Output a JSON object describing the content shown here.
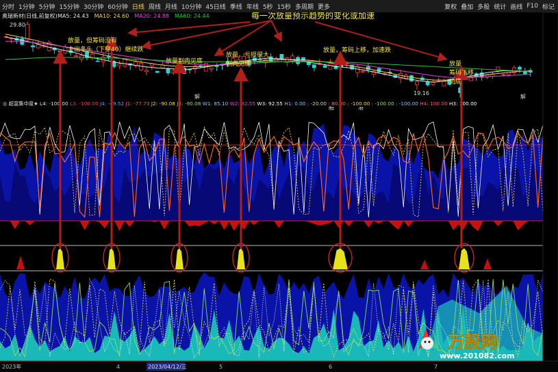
{
  "toolbar": {
    "left": [
      "分时",
      "1分钟",
      "5分钟",
      "15分钟",
      "30分钟",
      "60分钟",
      "日线",
      "周线",
      "月线",
      "10分钟",
      "45日线",
      "季线",
      "年线",
      "5秒",
      "15秒",
      "多周期",
      "更多"
    ],
    "active_index": 6,
    "right": [
      "复权",
      "叠加",
      "多股",
      "统计",
      "画线",
      "F10",
      "标记"
    ]
  },
  "colors": {
    "ma5": "#e8e8e8",
    "ma10": "#f2d24a",
    "ma20": "#e040e0",
    "ma60": "#31c23b",
    "up": "#ff3c3c",
    "down": "#2fd0d0",
    "navy": "#0a13a8",
    "deep": "#06086a",
    "cyan": "#1ab9b9",
    "red": "#c4120e",
    "yellow": "#e7e21c",
    "annotation": "#f5e54a",
    "arrow": "#b0201a"
  },
  "chart_data": [
    {
      "type": "candlestick",
      "title": "奥瑞新材(日线,前复权)",
      "legend": [
        {
          "name": "MA5",
          "value": "24.43"
        },
        {
          "name": "MA10",
          "value": "24.60"
        },
        {
          "name": "MA20",
          "value": "24.88"
        },
        {
          "name": "MA60",
          "value": "24.44"
        }
      ],
      "high_label": "29.80",
      "low_label": "19.16",
      "ylim": [
        18.5,
        30.5
      ],
      "ma_lines": {
        "ma5": [
          27.4,
          27.0,
          26.6,
          26.0,
          25.6,
          25.2,
          24.6,
          24.2,
          23.8,
          23.5,
          23.2,
          23.0,
          22.9,
          22.8,
          23.0,
          23.3,
          23.6,
          23.9,
          24.2,
          24.4,
          24.3,
          24.1,
          23.8,
          23.5,
          23.2,
          23.0,
          22.7,
          22.3,
          21.9,
          21.5,
          21.2,
          21.0,
          21.2,
          21.6,
          22.0,
          22.4,
          22.6,
          22.6,
          22.5
        ],
        "ma10": [
          27.8,
          27.4,
          27.0,
          26.5,
          26.1,
          25.7,
          25.3,
          24.9,
          24.5,
          24.1,
          23.8,
          23.5,
          23.3,
          23.2,
          23.2,
          23.3,
          23.5,
          23.7,
          23.9,
          24.1,
          24.2,
          24.2,
          24.1,
          23.9,
          23.6,
          23.3,
          23.0,
          22.6,
          22.2,
          21.8,
          21.5,
          21.3,
          21.3,
          21.5,
          21.8,
          22.1,
          22.3,
          22.5,
          22.6
        ],
        "ma20": [
          26.8,
          26.8,
          26.6,
          26.4,
          26.1,
          25.8,
          25.5,
          25.2,
          24.9,
          24.6,
          24.3,
          24.0,
          23.8,
          23.6,
          23.5,
          23.4,
          23.5,
          23.6,
          23.7,
          23.8,
          23.9,
          24.0,
          24.0,
          23.9,
          23.8,
          23.6,
          23.4,
          23.1,
          22.8,
          22.5,
          22.2,
          21.9,
          21.7,
          21.6,
          21.7,
          21.8,
          21.9,
          22.0,
          22.1
        ],
        "ma60": [
          24.2,
          24.3,
          24.4,
          24.5,
          24.5,
          24.5,
          24.5,
          24.4,
          24.4,
          24.3,
          24.2,
          24.1,
          24.0,
          23.9,
          23.9,
          23.9,
          23.9,
          23.9,
          23.9,
          23.9,
          23.9,
          23.9,
          23.9,
          23.9,
          23.8,
          23.8,
          23.7,
          23.6,
          23.5,
          23.4,
          23.3,
          23.2,
          23.1,
          23.0,
          22.9,
          22.8,
          22.7,
          22.6,
          22.5
        ]
      }
    },
    {
      "type": "area",
      "title": "超富集中度",
      "legend": [
        {
          "name": "L4",
          "value": "-100.00"
        },
        {
          "name": "L3",
          "value": "-100.00"
        },
        {
          "name": "J4",
          "value": "-49.52"
        },
        {
          "name": "J1",
          "value": "-77.73"
        },
        {
          "name": "J2",
          "value": "-90.08"
        },
        {
          "name": "J3",
          "value": "-90.08"
        },
        {
          "name": "W1",
          "value": "85.10"
        },
        {
          "name": "W2",
          "value": "92.55"
        },
        {
          "name": "W3",
          "value": "92.55"
        },
        {
          "name": "H1",
          "value": "0.00"
        },
        {
          "name": "",
          "value": "-20.00"
        },
        {
          "name": "",
          "value": "80.00"
        },
        {
          "name": "",
          "value": "-100.00"
        },
        {
          "name": "",
          "value": "-100.00"
        },
        {
          "name": "",
          "value": "-100.00"
        },
        {
          "name": "H4",
          "value": "100.00"
        },
        {
          "name": "H3",
          "value": "100.00"
        }
      ],
      "ylim": [
        -100,
        100
      ]
    }
  ],
  "annotations": {
    "title": "每一次放量预示趋势的变化或加速",
    "a1_line1": "放量，但筹码没有",
    "a1_line2": "主出冬头（下穿40）继续跌",
    "a2": "放量割肉见底",
    "a3_line1": "放量，亏损很大",
    "a3_line2": "割肉见底",
    "a4": "放量，筹码上移，加速跌",
    "a5_line1": "放量",
    "a5_line2": "筹码下移",
    "a5_line3": "见底"
  },
  "axis": {
    "x_labels": [
      "2023年",
      "4",
      "2023/04/12/三",
      "5",
      "6",
      "7"
    ],
    "markers": [
      "解",
      "解"
    ],
    "events": [
      "融",
      "港"
    ]
  },
  "watermark": {
    "brand": "万股网",
    "url": "www.201082.com"
  }
}
